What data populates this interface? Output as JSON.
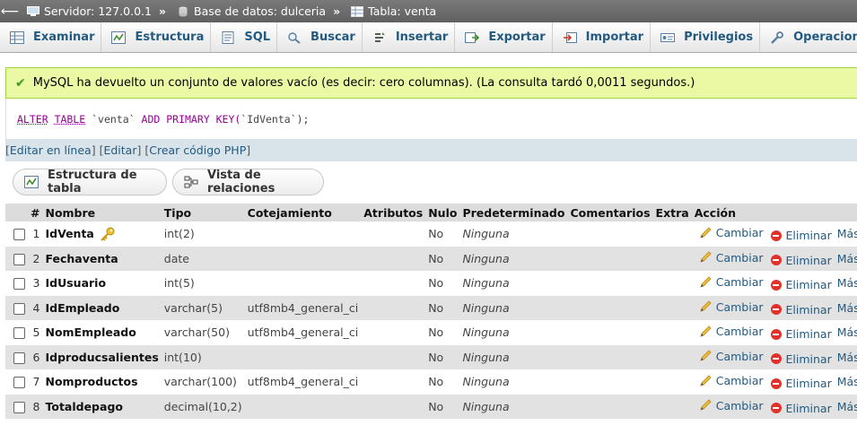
{
  "breadcrumb": {
    "server_label": "Servidor: 127.0.0.1",
    "database_label": "Base de datos: dulceria",
    "table_label": "Tabla: venta",
    "separator": "»"
  },
  "tabs": [
    {
      "label": "Examinar",
      "icon": "browse-icon"
    },
    {
      "label": "Estructura",
      "icon": "structure-icon"
    },
    {
      "label": "SQL",
      "icon": "sql-icon"
    },
    {
      "label": "Buscar",
      "icon": "search-icon"
    },
    {
      "label": "Insertar",
      "icon": "insert-icon"
    },
    {
      "label": "Exportar",
      "icon": "export-icon"
    },
    {
      "label": "Importar",
      "icon": "import-icon"
    },
    {
      "label": "Privilegios",
      "icon": "privileges-icon"
    },
    {
      "label": "Operaciones",
      "icon": "wrench-icon"
    }
  ],
  "message": {
    "text": "MySQL ha devuelto un conjunto de valores vacío (es decir: cero columnas). (La consulta tardó 0,0011 segundos.)"
  },
  "sql": {
    "kw1": "ALTER",
    "kw2": "TABLE",
    "table": "`venta`",
    "kw3": "ADD PRIMARY KEY(",
    "column": "`IdVenta`",
    "end": ");"
  },
  "links": {
    "open": "[",
    "close": "]",
    "edit_inline": "Editar en línea",
    "edit": "Editar",
    "create_php": "Crear código PHP"
  },
  "buttons": {
    "table_structure": "Estructura de tabla",
    "relation_view": "Vista de relaciones"
  },
  "table": {
    "headers": {
      "num": "#",
      "name": "Nombre",
      "type": "Tipo",
      "collation": "Cotejamiento",
      "attributes": "Atributos",
      "null": "Nulo",
      "default": "Predeterminado",
      "comments": "Comentarios",
      "extra": "Extra",
      "action": "Acción"
    },
    "action_labels": {
      "change": "Cambiar",
      "drop": "Eliminar",
      "more": "Más"
    },
    "rows": [
      {
        "num": "1",
        "name": "IdVenta",
        "type": "int(2)",
        "collation": "",
        "null": "No",
        "default": "Ninguna",
        "primary": true
      },
      {
        "num": "2",
        "name": "Fechaventa",
        "type": "date",
        "collation": "",
        "null": "No",
        "default": "Ninguna"
      },
      {
        "num": "3",
        "name": "IdUsuario",
        "type": "int(5)",
        "collation": "",
        "null": "No",
        "default": "Ninguna"
      },
      {
        "num": "4",
        "name": "IdEmpleado",
        "type": "varchar(5)",
        "collation": "utf8mb4_general_ci",
        "null": "No",
        "default": "Ninguna"
      },
      {
        "num": "5",
        "name": "NomEmpleado",
        "type": "varchar(50)",
        "collation": "utf8mb4_general_ci",
        "null": "No",
        "default": "Ninguna"
      },
      {
        "num": "6",
        "name": "Idproducsalientes",
        "type": "int(10)",
        "collation": "",
        "null": "No",
        "default": "Ninguna"
      },
      {
        "num": "7",
        "name": "Nomproductos",
        "type": "varchar(100)",
        "collation": "utf8mb4_general_ci",
        "null": "No",
        "default": "Ninguna"
      },
      {
        "num": "8",
        "name": "Totaldepago",
        "type": "decimal(10,2)",
        "collation": "",
        "null": "No",
        "default": "Ninguna"
      }
    ]
  },
  "colors": {
    "link": "#235a81",
    "success_bg": "#ebf8a4",
    "header_bg": "#dcdcdc",
    "row_alt": "#e2e2e2",
    "drop": "#e0322b"
  }
}
